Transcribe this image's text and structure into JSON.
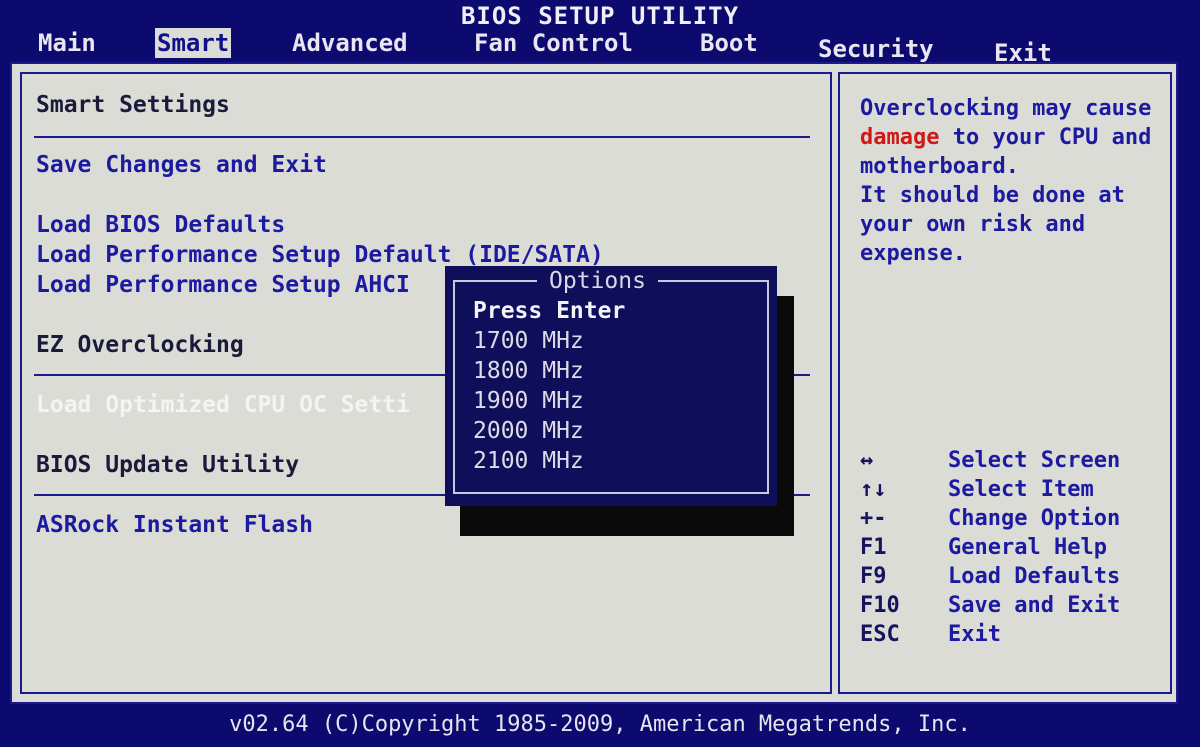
{
  "title": "BIOS SETUP UTILITY",
  "menu": [
    "Main",
    "Smart",
    "Advanced",
    "Fan Control",
    "Boot",
    "Security",
    "Exit"
  ],
  "left": {
    "heading": "Smart Settings",
    "save_exit": "Save Changes and Exit",
    "load_defaults": "Load BIOS Defaults",
    "load_perf_ide": "Load Performance Setup Default (IDE/SATA)",
    "load_perf_ahci": "Load Performance Setup AHCI",
    "ez_oc": "EZ Overclocking",
    "load_opt_cpu": "Load Optimized CPU OC Setti",
    "bios_update": "BIOS Update Utility",
    "instant_flash": "ASRock Instant Flash"
  },
  "help": {
    "line1": "Overclocking may cause",
    "warn": "damage",
    "line2_rest": " to your CPU and",
    "line3": "motherboard.",
    "line4": "It should be done at",
    "line5": "your own risk and",
    "line6": "expense."
  },
  "keys": [
    {
      "key": "↔",
      "desc": "Select Screen"
    },
    {
      "key": "↑↓",
      "desc": "Select Item"
    },
    {
      "key": "+-",
      "desc": "Change Option"
    },
    {
      "key": "F1",
      "desc": "General Help"
    },
    {
      "key": "F9",
      "desc": "Load Defaults"
    },
    {
      "key": "F10",
      "desc": "Save and Exit"
    },
    {
      "key": "ESC",
      "desc": "Exit"
    }
  ],
  "popup": {
    "title": "Options",
    "options": [
      "Press Enter",
      "1700 MHz",
      "1800 MHz",
      "1900 MHz",
      "2000 MHz",
      "2100 MHz"
    ]
  },
  "footer": "v02.64 (C)Copyright 1985-2009, American Megatrends, Inc."
}
